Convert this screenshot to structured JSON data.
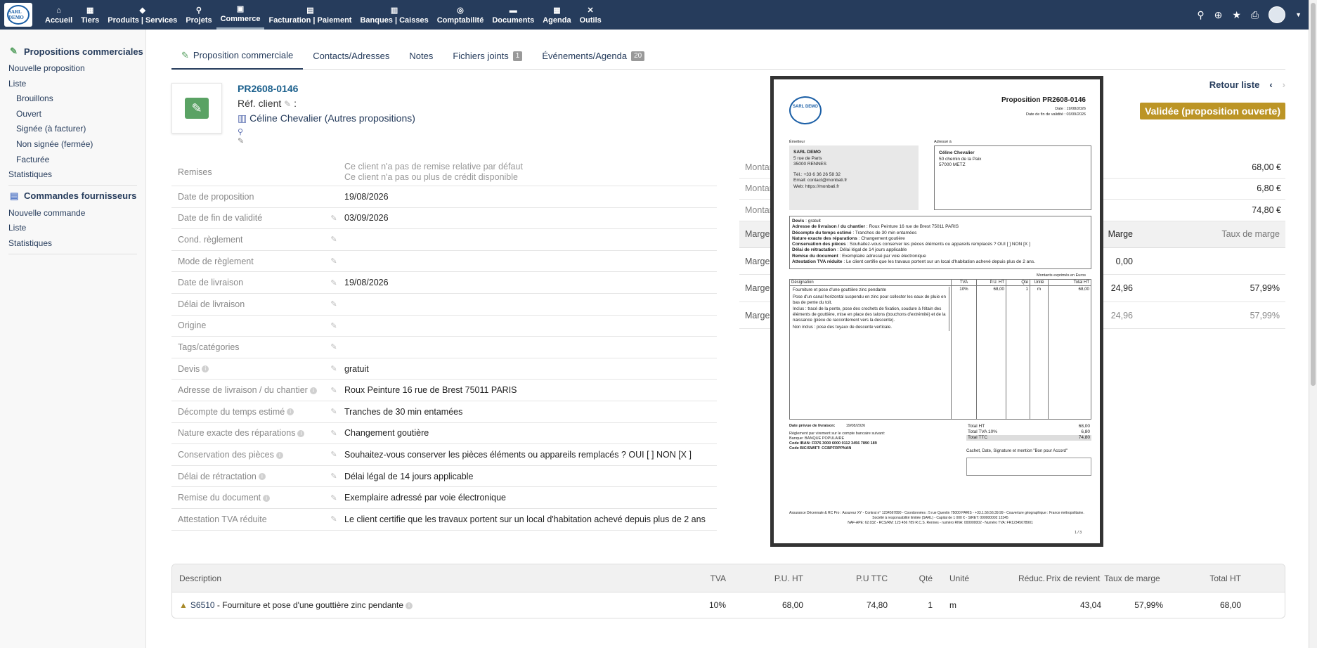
{
  "app": {
    "logo_text": "SARL DEMO"
  },
  "menu": [
    {
      "label": "Accueil",
      "icon": "home-icon",
      "glyph": "⌂"
    },
    {
      "label": "Tiers",
      "icon": "building-icon",
      "glyph": "▦"
    },
    {
      "label": "Produits | Services",
      "icon": "cube-icon",
      "glyph": "◆"
    },
    {
      "label": "Projets",
      "icon": "sitemap-icon",
      "glyph": "⚲"
    },
    {
      "label": "Commerce",
      "icon": "suitcase-icon",
      "glyph": "▣"
    },
    {
      "label": "Facturation | Paiement",
      "icon": "invoice-icon",
      "glyph": "▤"
    },
    {
      "label": "Banques | Caisses",
      "icon": "bank-icon",
      "glyph": "▥"
    },
    {
      "label": "Comptabilité",
      "icon": "search-dollar-icon",
      "glyph": "◎"
    },
    {
      "label": "Documents",
      "icon": "folder-icon",
      "glyph": "▬"
    },
    {
      "label": "Agenda",
      "icon": "calendar-icon",
      "glyph": "▦"
    },
    {
      "label": "Outils",
      "icon": "tools-icon",
      "glyph": "✕"
    }
  ],
  "sidebar": {
    "section1": {
      "title": "Propositions commerciales",
      "items": [
        "Nouvelle proposition",
        "Liste",
        "Brouillons",
        "Ouvert",
        "Signée (à facturer)",
        "Non signée (fermée)",
        "Facturée",
        "Statistiques"
      ]
    },
    "section2": {
      "title": "Commandes fournisseurs",
      "items": [
        "Nouvelle commande",
        "Liste",
        "Statistiques"
      ]
    }
  },
  "tabs": [
    {
      "label": "Proposition commerciale",
      "badge": null
    },
    {
      "label": "Contacts/Adresses",
      "badge": null
    },
    {
      "label": "Notes",
      "badge": null
    },
    {
      "label": "Fichiers joints",
      "badge": "1"
    },
    {
      "label": "Événements/Agenda",
      "badge": "20"
    }
  ],
  "header": {
    "ref": "PR2608-0146",
    "ref_client_label": "Réf. client",
    "ref_client_suffix": ":",
    "thirdparty": "Céline Chevalier (Autres propositions)",
    "back_link": "Retour liste",
    "status": "Validée (proposition ouverte)"
  },
  "fields": [
    {
      "label": "Remises",
      "value": "Ce client n'a pas de remise relative par défaut",
      "value2": "Ce client n'a pas ou plus de crédit disponible",
      "info": false,
      "editable": false
    },
    {
      "label": "Date de proposition",
      "value": "19/08/2026",
      "info": false,
      "editable": false
    },
    {
      "label": "Date de fin de validité",
      "value": "03/09/2026",
      "info": false,
      "editable": true
    },
    {
      "label": "Cond. règlement",
      "value": "",
      "info": false,
      "editable": true
    },
    {
      "label": "Mode de règlement",
      "value": "",
      "info": false,
      "editable": true
    },
    {
      "label": "Date de livraison",
      "value": "19/08/2026",
      "info": false,
      "editable": true
    },
    {
      "label": "Délai de livraison",
      "value": "",
      "info": false,
      "editable": true
    },
    {
      "label": "Origine",
      "value": "",
      "info": false,
      "editable": true
    },
    {
      "label": "Tags/catégories",
      "value": "",
      "info": false,
      "editable": true
    },
    {
      "label": "Devis",
      "value": "gratuit",
      "info": true,
      "editable": true
    },
    {
      "label": "Adresse de livraison / du chantier",
      "value": "Roux Peinture 16 rue de Brest 75011 PARIS",
      "info": true,
      "editable": true
    },
    {
      "label": "Décompte du temps estimé",
      "value": "Tranches de 30 min entamées",
      "info": true,
      "editable": true
    },
    {
      "label": "Nature exacte des réparations",
      "value": "Changement goutière",
      "info": true,
      "editable": true
    },
    {
      "label": "Conservation des pièces",
      "value": "Souhaitez-vous conserver les pièces éléments ou appareils remplacés ? OUI [ ] NON [X ]",
      "info": true,
      "editable": true
    },
    {
      "label": "Délai de rétractation",
      "value": "Délai légal de 14 jours applicable",
      "info": true,
      "editable": true
    },
    {
      "label": "Remise du document",
      "value": "Exemplaire adressé par voie électronique",
      "info": true,
      "editable": true
    },
    {
      "label": "Attestation TVA réduite",
      "value": "Le client certifie que les travaux portent sur un local d'habitation achevé depuis plus de 2 ans",
      "info": false,
      "editable": true
    }
  ],
  "amounts": [
    {
      "label": "Montant",
      "value": "68,00 €"
    },
    {
      "label": "Montant",
      "value": "6,80 €"
    },
    {
      "label": "Montant",
      "value": "74,80 €"
    }
  ],
  "margin_table": {
    "headers": [
      "Marge",
      "Marge",
      "Taux de marge"
    ],
    "rows": [
      {
        "label": "Marge",
        "marge": "0,00",
        "taux": ""
      },
      {
        "label": "Marge",
        "marge": "24,96",
        "taux": "57,99%"
      },
      {
        "label": "Marge",
        "marge": "24,96",
        "taux": "57,99%"
      }
    ]
  },
  "preview": {
    "logo": "SARL DEMO",
    "title": "Proposition PR2608-0146",
    "date": "Date : 19/08/2026",
    "validity": "Date de fin de validité : 03/09/2026",
    "emitter_label": "Émetteur",
    "dest_label": "Adressé à",
    "emitter": [
      "SARL DEMO",
      "5 rue de Paris",
      "35000 RENNES",
      "",
      "Tél.: +33 6 36 26 58 32",
      "Email: contact@monbati.fr",
      "Web: https://monbati.fr"
    ],
    "dest": [
      "Céline Chevalier",
      "50 chemin de la Paix",
      "57000 METZ"
    ],
    "extra": [
      {
        "k": "Devis",
        "v": "gratuit"
      },
      {
        "k": "Adresse de livraison / du chantier",
        "v": "Roux Peinture 16 rue de Brest 75011 PARIS"
      },
      {
        "k": "Décompte du temps estimé",
        "v": "Tranches de 30 min entamées"
      },
      {
        "k": "Nature exacte des réparations",
        "v": "Changement goutière"
      },
      {
        "k": "Conservation des pièces",
        "v": "Souhaitez-vous conserver les pièces éléments ou appareils remplacés ? OUI [ ] NON [X ]"
      },
      {
        "k": "Délai de rétractation",
        "v": "Délai légal de 14 jours applicable"
      },
      {
        "k": "Remise du document",
        "v": "Exemplaire adressé par voie électronique"
      },
      {
        "k": "Attestation TVA réduite",
        "v": "Le client certifie que les travaux portent sur un local d'habitation achevé depuis plus de 2 ans."
      }
    ],
    "currency": "Montants exprimés en Euros",
    "line_headers": [
      "Désignation",
      "TVA",
      "P.U. HT",
      "Qté",
      "Unité",
      "Total HT"
    ],
    "line": {
      "desc": [
        "Fourniture et pose d'une gouttière zinc pendante",
        "Pose d'un canal horizontal suspendu en zinc pour collecter les eaux de pluie en bas de pente du toit.",
        "Inclus : tracé de la pente, pose des crochets de fixation, soudure à l'étain des éléments de gouttière, mise en place des talons (bouchons d'extrémité) et de la naissance (pièce de raccordement vers la descente).",
        "Non inclus : pose des tuyaux de descente verticale."
      ],
      "tva": "10%",
      "pu": "68,00",
      "qty": "1",
      "unit": "m",
      "total": "68,00"
    },
    "delivery_label": "Date prévue de livraison:",
    "delivery_date": "19/08/2026",
    "bank": [
      "Règlement par virement sur le compte bancaire suivant:",
      "Banque: BANQUE POPULAIRE",
      "Code IBAN: FR76 3000 6000 0112 3456 7890 189",
      "Code BIC/SWIFT: CCBPFRPPNAN"
    ],
    "totals": [
      {
        "k": "Total HT",
        "v": "68,00"
      },
      {
        "k": "Total TVA 10%",
        "v": "6,80"
      },
      {
        "k": "Total TTC",
        "v": "74,80"
      }
    ],
    "sign": "Cachet, Date, Signature et mention \"Bon pour Accord\"",
    "legal": [
      "Assurance Décennale & RC Pro : Assureur XY - Contrat n° 1234567890 - Coordonnées : 5 rue Quentin 75000 PARIS - +33.1.56.56.39.99 - Couverture géographique : France métropolitaine.",
      "Société à responsabilité limitée (SARL) - Capital de 1 000 € - SIRET: 000000002 12345",
      "NAF-APE: 62.03Z - RCS/RM: 123 456 789 R.C.S. Rennes - numéro RNA: 000000002 - Numéro TVA: FR12345678901"
    ],
    "page": "1 / 3"
  },
  "lines_table": {
    "headers": {
      "desc": "Description",
      "tva": "TVA",
      "puht": "P.U. HT",
      "puttc": "P.U TTC",
      "qte": "Qté",
      "unit": "Unité",
      "reduc": "Réduc.",
      "prix": "Prix de revient",
      "marge": "Taux de marge",
      "total": "Total HT"
    },
    "row": {
      "ref": "S6510",
      "label": " - Fourniture et pose d'une gouttière zinc pendante",
      "tva": "10%",
      "puht": "68,00",
      "puttc": "74,80",
      "qte": "1",
      "unit": "m",
      "reduc": "",
      "prix": "43,04",
      "marge": "57,99%",
      "total": "68,00"
    }
  }
}
